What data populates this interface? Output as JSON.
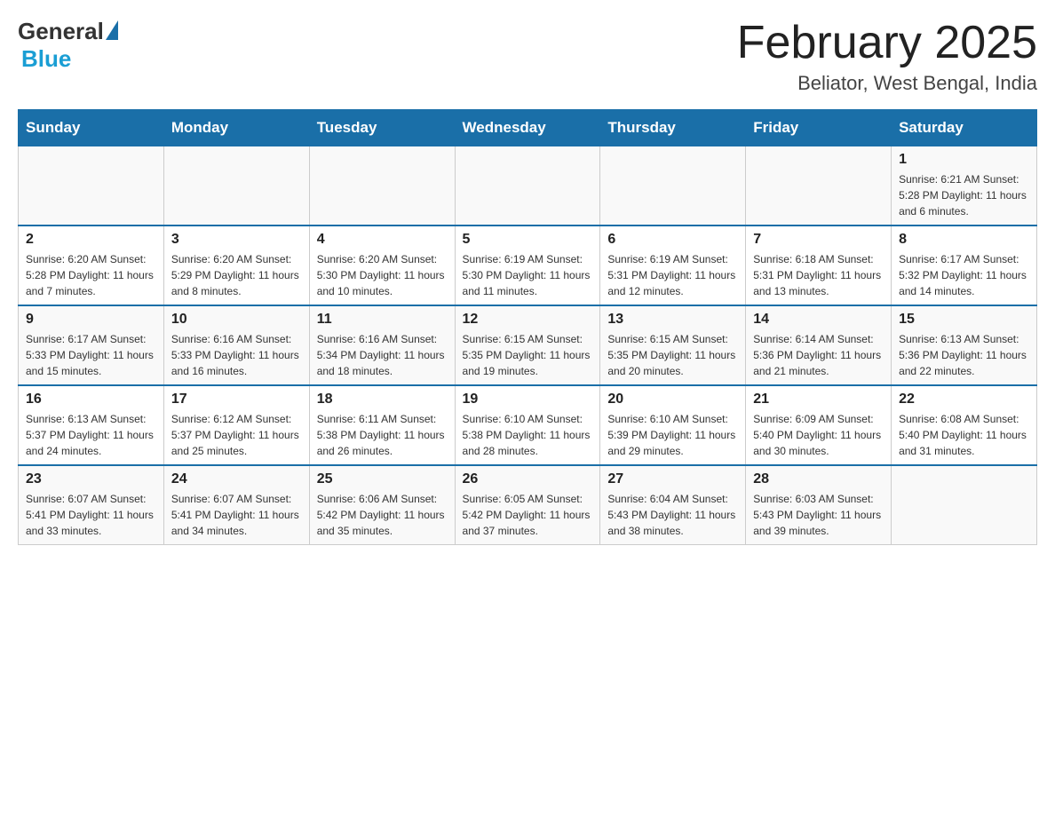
{
  "logo": {
    "general": "General",
    "blue": "Blue"
  },
  "title": "February 2025",
  "location": "Beliator, West Bengal, India",
  "weekdays": [
    "Sunday",
    "Monday",
    "Tuesday",
    "Wednesday",
    "Thursday",
    "Friday",
    "Saturday"
  ],
  "weeks": [
    [
      {
        "day": "",
        "info": ""
      },
      {
        "day": "",
        "info": ""
      },
      {
        "day": "",
        "info": ""
      },
      {
        "day": "",
        "info": ""
      },
      {
        "day": "",
        "info": ""
      },
      {
        "day": "",
        "info": ""
      },
      {
        "day": "1",
        "info": "Sunrise: 6:21 AM\nSunset: 5:28 PM\nDaylight: 11 hours and 6 minutes."
      }
    ],
    [
      {
        "day": "2",
        "info": "Sunrise: 6:20 AM\nSunset: 5:28 PM\nDaylight: 11 hours and 7 minutes."
      },
      {
        "day": "3",
        "info": "Sunrise: 6:20 AM\nSunset: 5:29 PM\nDaylight: 11 hours and 8 minutes."
      },
      {
        "day": "4",
        "info": "Sunrise: 6:20 AM\nSunset: 5:30 PM\nDaylight: 11 hours and 10 minutes."
      },
      {
        "day": "5",
        "info": "Sunrise: 6:19 AM\nSunset: 5:30 PM\nDaylight: 11 hours and 11 minutes."
      },
      {
        "day": "6",
        "info": "Sunrise: 6:19 AM\nSunset: 5:31 PM\nDaylight: 11 hours and 12 minutes."
      },
      {
        "day": "7",
        "info": "Sunrise: 6:18 AM\nSunset: 5:31 PM\nDaylight: 11 hours and 13 minutes."
      },
      {
        "day": "8",
        "info": "Sunrise: 6:17 AM\nSunset: 5:32 PM\nDaylight: 11 hours and 14 minutes."
      }
    ],
    [
      {
        "day": "9",
        "info": "Sunrise: 6:17 AM\nSunset: 5:33 PM\nDaylight: 11 hours and 15 minutes."
      },
      {
        "day": "10",
        "info": "Sunrise: 6:16 AM\nSunset: 5:33 PM\nDaylight: 11 hours and 16 minutes."
      },
      {
        "day": "11",
        "info": "Sunrise: 6:16 AM\nSunset: 5:34 PM\nDaylight: 11 hours and 18 minutes."
      },
      {
        "day": "12",
        "info": "Sunrise: 6:15 AM\nSunset: 5:35 PM\nDaylight: 11 hours and 19 minutes."
      },
      {
        "day": "13",
        "info": "Sunrise: 6:15 AM\nSunset: 5:35 PM\nDaylight: 11 hours and 20 minutes."
      },
      {
        "day": "14",
        "info": "Sunrise: 6:14 AM\nSunset: 5:36 PM\nDaylight: 11 hours and 21 minutes."
      },
      {
        "day": "15",
        "info": "Sunrise: 6:13 AM\nSunset: 5:36 PM\nDaylight: 11 hours and 22 minutes."
      }
    ],
    [
      {
        "day": "16",
        "info": "Sunrise: 6:13 AM\nSunset: 5:37 PM\nDaylight: 11 hours and 24 minutes."
      },
      {
        "day": "17",
        "info": "Sunrise: 6:12 AM\nSunset: 5:37 PM\nDaylight: 11 hours and 25 minutes."
      },
      {
        "day": "18",
        "info": "Sunrise: 6:11 AM\nSunset: 5:38 PM\nDaylight: 11 hours and 26 minutes."
      },
      {
        "day": "19",
        "info": "Sunrise: 6:10 AM\nSunset: 5:38 PM\nDaylight: 11 hours and 28 minutes."
      },
      {
        "day": "20",
        "info": "Sunrise: 6:10 AM\nSunset: 5:39 PM\nDaylight: 11 hours and 29 minutes."
      },
      {
        "day": "21",
        "info": "Sunrise: 6:09 AM\nSunset: 5:40 PM\nDaylight: 11 hours and 30 minutes."
      },
      {
        "day": "22",
        "info": "Sunrise: 6:08 AM\nSunset: 5:40 PM\nDaylight: 11 hours and 31 minutes."
      }
    ],
    [
      {
        "day": "23",
        "info": "Sunrise: 6:07 AM\nSunset: 5:41 PM\nDaylight: 11 hours and 33 minutes."
      },
      {
        "day": "24",
        "info": "Sunrise: 6:07 AM\nSunset: 5:41 PM\nDaylight: 11 hours and 34 minutes."
      },
      {
        "day": "25",
        "info": "Sunrise: 6:06 AM\nSunset: 5:42 PM\nDaylight: 11 hours and 35 minutes."
      },
      {
        "day": "26",
        "info": "Sunrise: 6:05 AM\nSunset: 5:42 PM\nDaylight: 11 hours and 37 minutes."
      },
      {
        "day": "27",
        "info": "Sunrise: 6:04 AM\nSunset: 5:43 PM\nDaylight: 11 hours and 38 minutes."
      },
      {
        "day": "28",
        "info": "Sunrise: 6:03 AM\nSunset: 5:43 PM\nDaylight: 11 hours and 39 minutes."
      },
      {
        "day": "",
        "info": ""
      }
    ]
  ]
}
